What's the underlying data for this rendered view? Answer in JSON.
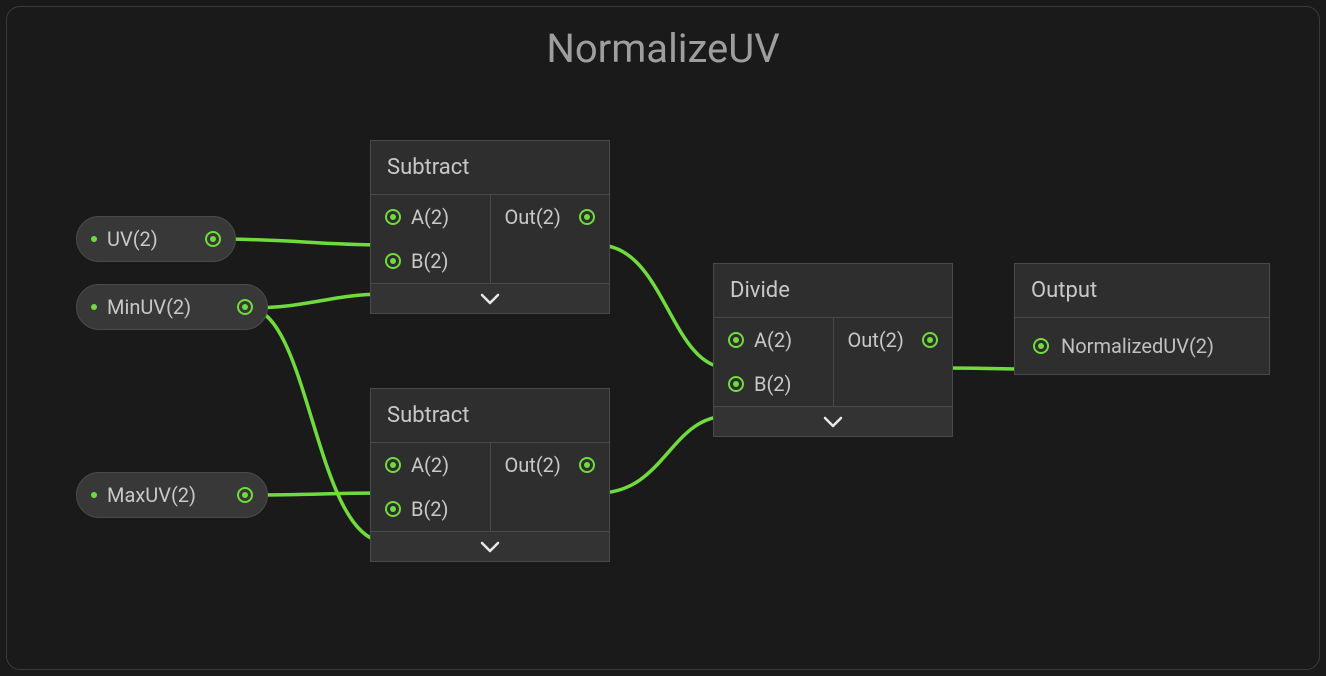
{
  "group": {
    "title": "NormalizeUV"
  },
  "params": {
    "uv": {
      "label": "UV(2)"
    },
    "minuv": {
      "label": "MinUV(2)"
    },
    "maxuv": {
      "label": "MaxUV(2)"
    }
  },
  "nodes": {
    "subtract1": {
      "title": "Subtract",
      "in_a": "A(2)",
      "in_b": "B(2)",
      "out": "Out(2)"
    },
    "subtract2": {
      "title": "Subtract",
      "in_a": "A(2)",
      "in_b": "B(2)",
      "out": "Out(2)"
    },
    "divide": {
      "title": "Divide",
      "in_a": "A(2)",
      "in_b": "B(2)",
      "out": "Out(2)"
    },
    "output": {
      "title": "Output",
      "in": "NormalizedUV(2)"
    }
  },
  "colors": {
    "accent": "#6fdb3c"
  }
}
